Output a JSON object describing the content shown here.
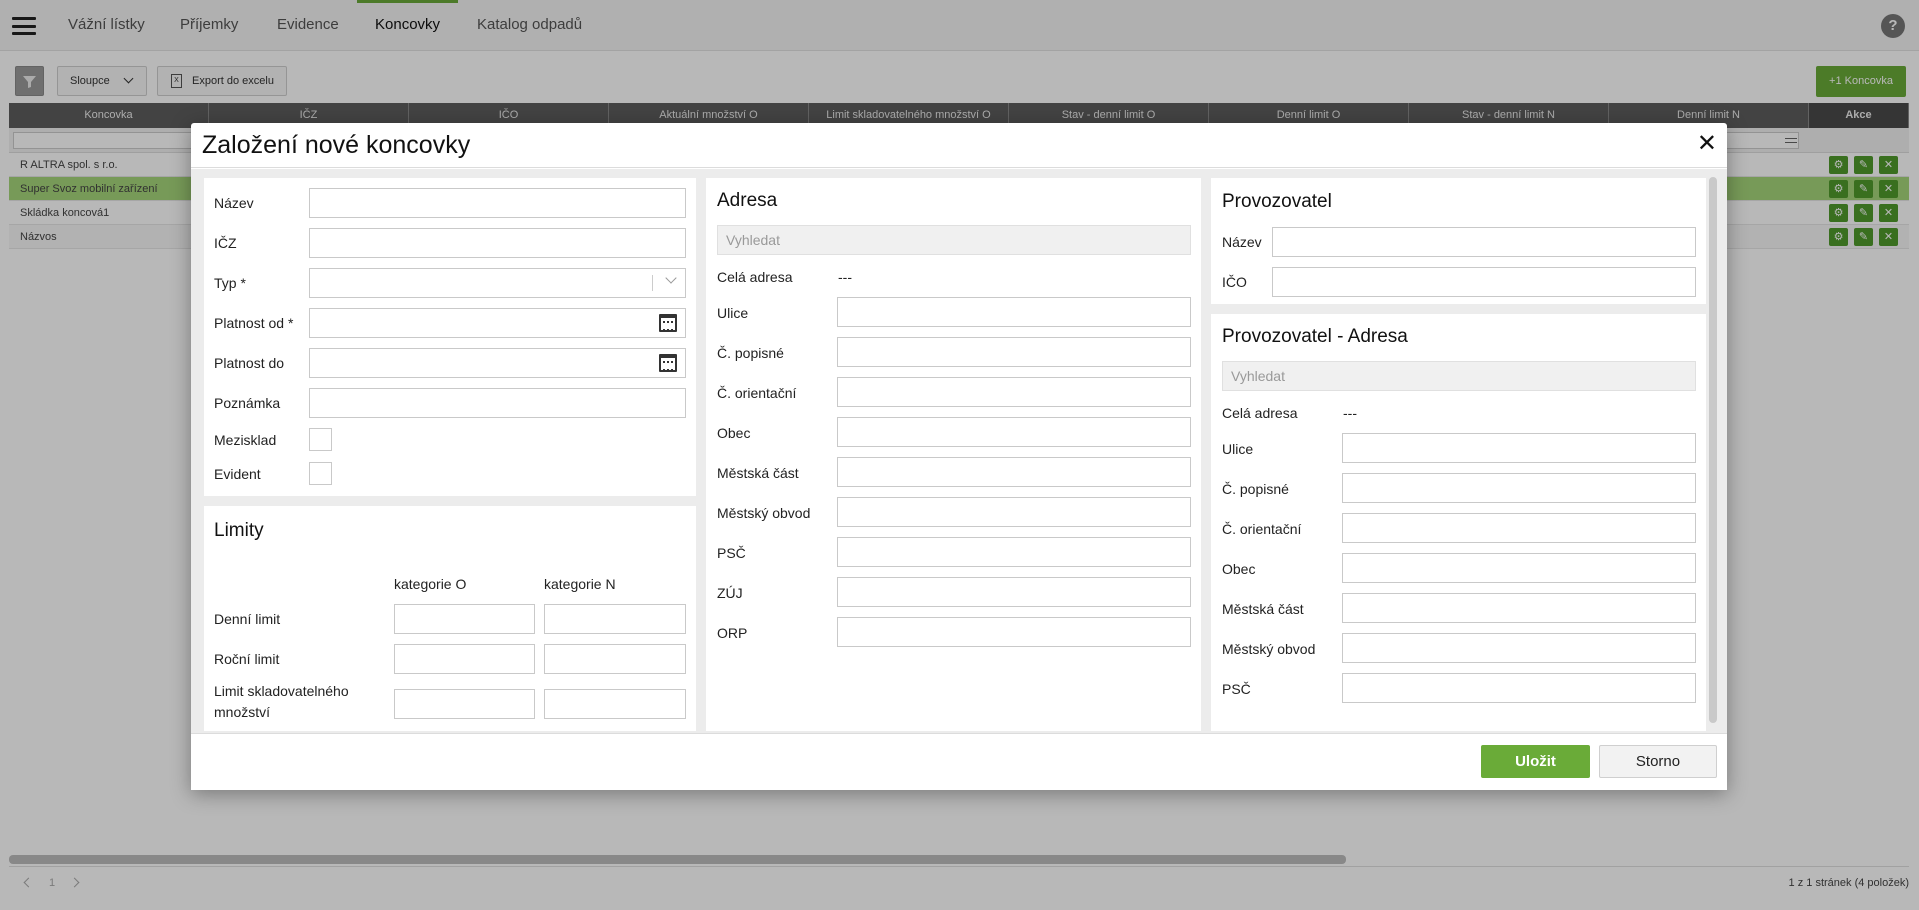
{
  "nav": {
    "tabs": [
      {
        "label": "Vážní lístky"
      },
      {
        "label": "Příjemky"
      },
      {
        "label": "Evidence"
      },
      {
        "label": "Koncovky"
      },
      {
        "label": "Katalog odpadů"
      }
    ],
    "active_tab": "Koncovky",
    "help_label": "?"
  },
  "toolbar": {
    "columns_label": "Sloupce",
    "export_label": "Export do excelu",
    "add_label": "+1 Koncovka"
  },
  "grid": {
    "columns": [
      "Koncovka",
      "IČZ",
      "IČO",
      "Aktuální množství O",
      "Limit skladovatelného množství O",
      "Stav - denní limit O",
      "Denní limit O",
      "Stav - denní limit N",
      "Denní limit N",
      "Akce"
    ],
    "rows": [
      {
        "name": "R ALTRA spol. s r.o."
      },
      {
        "name": "Super Svoz mobilní zařízení"
      },
      {
        "name": "Skládka koncová1"
      },
      {
        "name": "Názvos"
      }
    ],
    "selected_row": 1
  },
  "footer": {
    "page": "1",
    "info": "1 z 1 stránek (4 položek)"
  },
  "modal": {
    "title": "Založení nové koncovky",
    "close_label": "✕",
    "general": {
      "name_label": "Název",
      "icz_label": "IČZ",
      "type_label": "Typ *",
      "valid_from_label": "Platnost od *",
      "valid_to_label": "Platnost do",
      "note_label": "Poznámka",
      "mezisklad_label": "Mezisklad",
      "evident_label": "Evident"
    },
    "limits": {
      "title": "Limity",
      "col_o": "kategorie O",
      "col_n": "kategorie N",
      "daily_label": "Denní limit",
      "yearly_label": "Roční limit",
      "storage_label_1": "Limit skladovatelného",
      "storage_label_2": "množství"
    },
    "address": {
      "title": "Adresa",
      "search_placeholder": "Vyhledat",
      "full_address_label": "Celá adresa",
      "full_address_value": "---",
      "street_label": "Ulice",
      "house_no_label": "Č. popisné",
      "orientation_no_label": "Č. orientační",
      "city_label": "Obec",
      "city_part_label": "Městská část",
      "district_label": "Městský obvod",
      "zip_label": "PSČ",
      "zuj_label": "ZÚJ",
      "orp_label": "ORP"
    },
    "operator": {
      "title": "Provozovatel",
      "name_label": "Název",
      "ico_label": "IČO"
    },
    "operator_address": {
      "title": "Provozovatel - Adresa",
      "search_placeholder": "Vyhledat",
      "full_address_label": "Celá adresa",
      "full_address_value": "---",
      "street_label": "Ulice",
      "house_no_label": "Č. popisné",
      "orientation_no_label": "Č. orientační",
      "city_label": "Obec",
      "city_part_label": "Městská část",
      "district_label": "Městský obvod",
      "zip_label": "PSČ"
    },
    "save_label": "Uložit",
    "cancel_label": "Storno"
  }
}
